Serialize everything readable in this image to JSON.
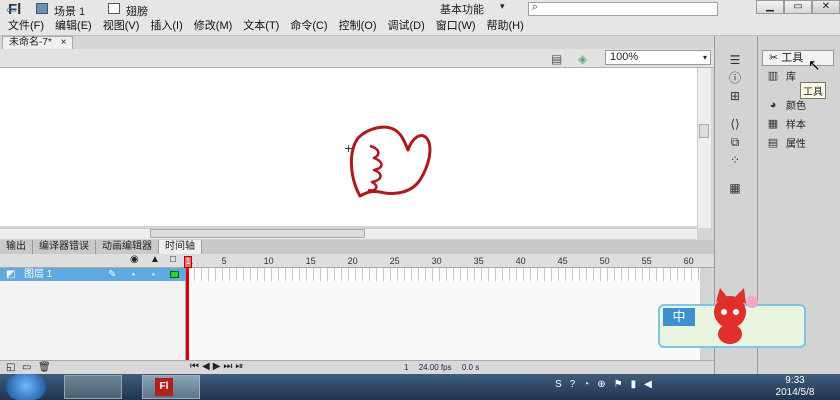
{
  "app": {
    "logo": "Fl",
    "workspace": "基本功能",
    "workspace_arrow": "▾",
    "search_icon": "⌕"
  },
  "menu": [
    "文件(F)",
    "编辑(E)",
    "视图(V)",
    "插入(I)",
    "修改(M)",
    "文本(T)",
    "命令(C)",
    "控制(O)",
    "调试(D)",
    "窗口(W)",
    "帮助(H)"
  ],
  "window_buttons": {
    "minimize": "▁",
    "maximize": "▭",
    "close": "✕"
  },
  "document_tab": {
    "title": "未命名-7*",
    "close": "×"
  },
  "scenebar": {
    "scene": "场景 1",
    "symbol": "翅膀",
    "zoom": "100%",
    "zoom_arrow": "▾"
  },
  "panel_tabs": [
    "输出",
    "编译器错误",
    "动画编辑器",
    "时间轴"
  ],
  "panel_active": "时间轴",
  "timeline": {
    "ruler": [
      "1",
      "5",
      "10",
      "15",
      "20",
      "25",
      "30",
      "35",
      "40",
      "45",
      "50",
      "55",
      "60"
    ],
    "layer": {
      "name": "图层 1",
      "icon": "layer-icon"
    },
    "header_icons": [
      "eye-icon",
      "lock-icon",
      "outline-icon"
    ],
    "status": {
      "frame": "1",
      "fps": "24.00 fps",
      "time": "0.0 s"
    }
  },
  "right_dock": {
    "items": [
      {
        "label": "工具",
        "icon": "tools-icon"
      },
      {
        "label": "库",
        "icon": "library-icon"
      },
      {
        "label": "颜色",
        "icon": "color-icon"
      },
      {
        "label": "样本",
        "icon": "swatches-icon"
      },
      {
        "label": "属性",
        "icon": "properties-icon"
      }
    ],
    "tooltip": "工具"
  },
  "ime": {
    "mode": "中"
  },
  "taskbar": {
    "time": "9:33",
    "date": "2014/5/8"
  },
  "colors": {
    "stroke": "#b0181c",
    "selection_blue": "#5fa8e0",
    "playhead": "#dd0000"
  }
}
